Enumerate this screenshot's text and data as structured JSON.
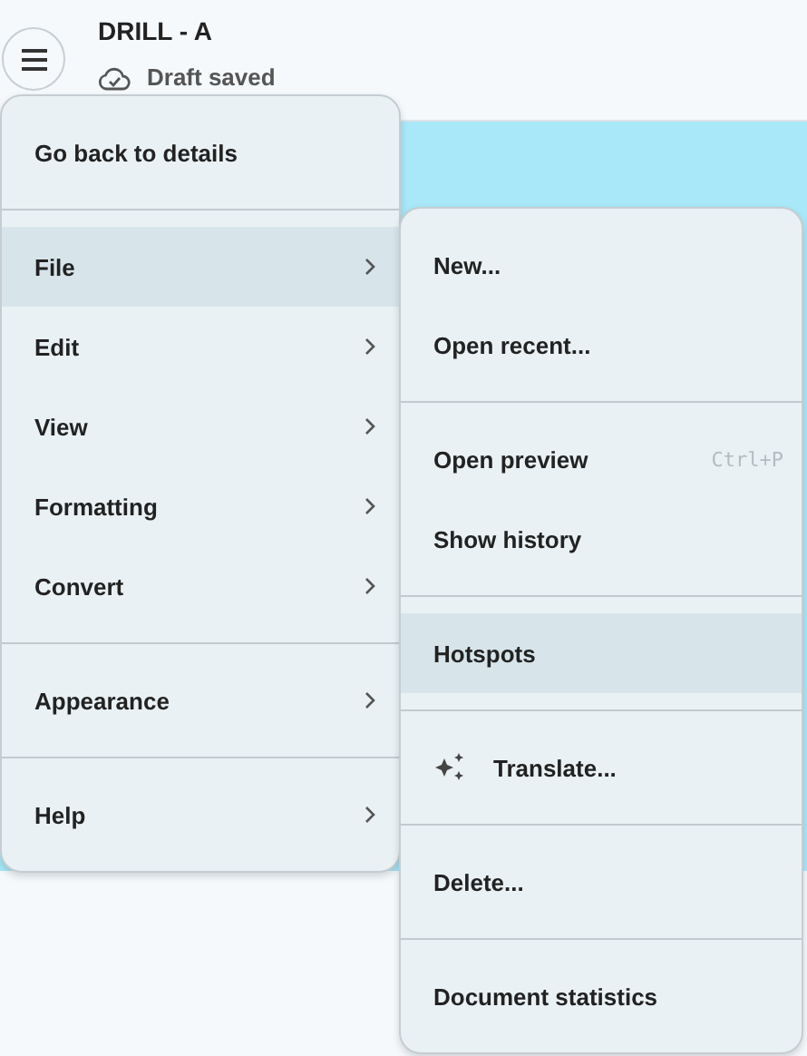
{
  "header": {
    "title": "DRILL - A",
    "status": "Draft saved"
  },
  "menu": {
    "groups": [
      [
        {
          "label": "Go back to details",
          "selected": false,
          "submenu": false
        }
      ],
      [
        {
          "label": "File",
          "selected": true,
          "submenu": true
        },
        {
          "label": "Edit",
          "selected": false,
          "submenu": true
        },
        {
          "label": "View",
          "selected": false,
          "submenu": true
        },
        {
          "label": "Formatting",
          "selected": false,
          "submenu": true
        },
        {
          "label": "Convert",
          "selected": false,
          "submenu": true
        }
      ],
      [
        {
          "label": "Appearance",
          "selected": false,
          "submenu": true
        }
      ],
      [
        {
          "label": "Help",
          "selected": false,
          "submenu": true
        }
      ]
    ]
  },
  "submenu": {
    "groups": [
      [
        {
          "label": "New...",
          "selected": false
        },
        {
          "label": "Open recent...",
          "selected": false
        }
      ],
      [
        {
          "label": "Open preview",
          "selected": false,
          "shortcut": "Ctrl+P"
        },
        {
          "label": "Show history",
          "selected": false
        }
      ],
      [
        {
          "label": "Hotspots",
          "selected": true
        }
      ],
      [
        {
          "label": "Translate...",
          "selected": false,
          "kind": "ai"
        }
      ],
      [
        {
          "label": "Delete...",
          "selected": false
        }
      ],
      [
        {
          "label": "Document statistics",
          "selected": false
        }
      ]
    ]
  }
}
